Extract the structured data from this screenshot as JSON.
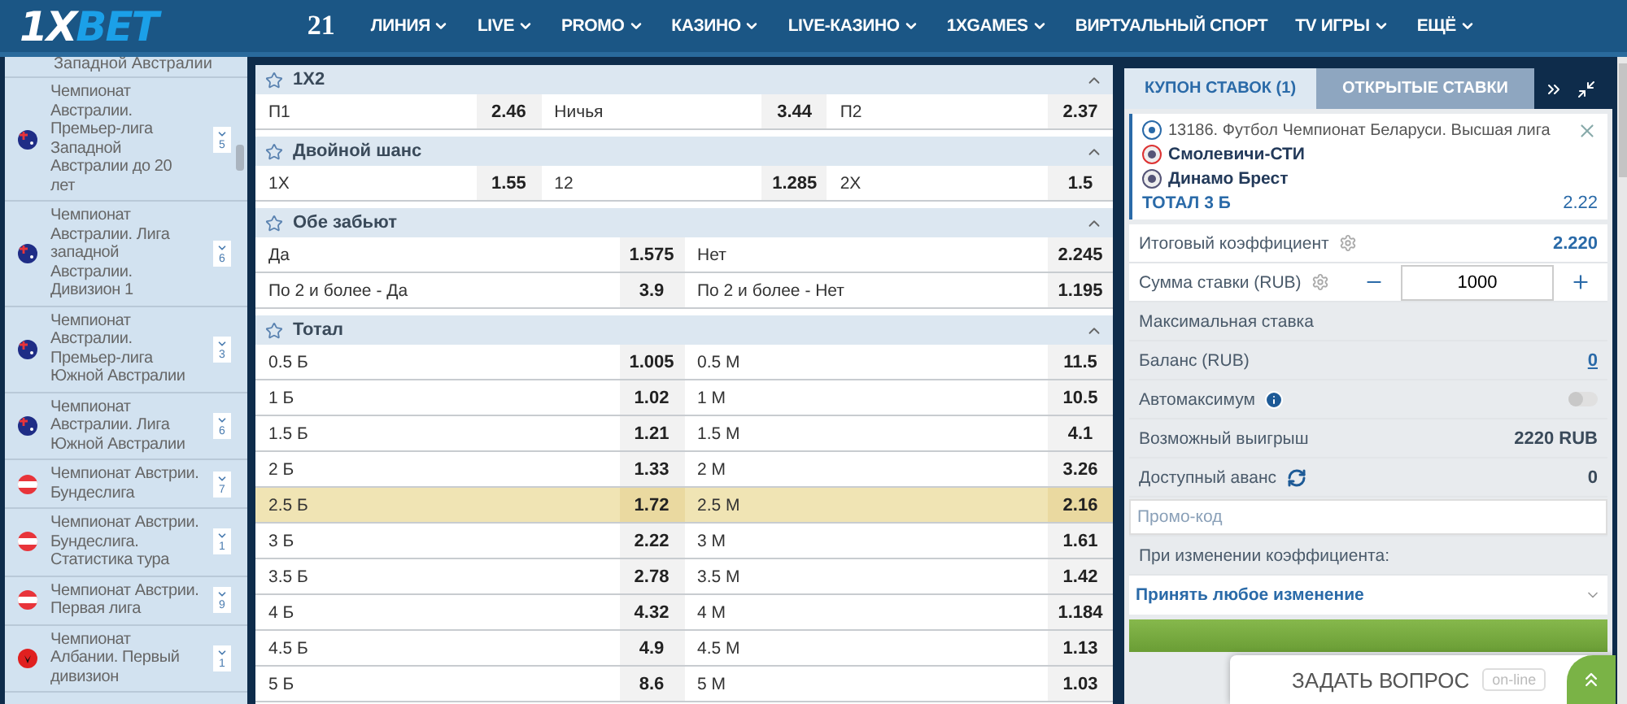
{
  "header": {
    "logo": {
      "part_1": "1X",
      "part_2": "BET"
    },
    "badge": "21",
    "nav": [
      {
        "label": "ЛИНИЯ",
        "dropdown": true
      },
      {
        "label": "LIVE",
        "dropdown": true
      },
      {
        "label": "PROMO",
        "dropdown": true
      },
      {
        "label": "КАЗИНО",
        "dropdown": true
      },
      {
        "label": "LIVE-КАЗИНО",
        "dropdown": true
      },
      {
        "label": "1XGAMES",
        "dropdown": true
      },
      {
        "label": "ВИРТУАЛЬНЫЙ СПОРТ",
        "dropdown": false
      },
      {
        "label": "TV ИГРЫ",
        "dropdown": true
      },
      {
        "label": "ЕЩЁ",
        "dropdown": true
      }
    ]
  },
  "sidebar": {
    "partial_item": "Западной Австралии",
    "items": [
      {
        "title": "Чемпионат Австралии. Премьер-лига Западной Австралии до 20 лет",
        "kind": "australia",
        "count": "5"
      },
      {
        "title": "Чемпионат Австралии. Лига западной Австралии. Дивизион 1",
        "kind": "australia",
        "count": "6"
      },
      {
        "title": "Чемпионат Австралии. Премьер-лига Южной Австралии",
        "kind": "australia",
        "count": "3"
      },
      {
        "title": "Чемпионат Австралии. Лига Южной Австралии",
        "kind": "australia",
        "count": "6"
      },
      {
        "title": "Чемпионат Австрии. Бундеслига",
        "kind": "austria",
        "count": "7"
      },
      {
        "title": "Чемпионат Австрии. Бундеслига. Статистика тура",
        "kind": "austria",
        "count": "1"
      },
      {
        "title": "Чемпионат Австрии. Первая лига",
        "kind": "austria",
        "count": "9"
      },
      {
        "title": "Чемпионат Албании. Первый дивизион",
        "kind": "albania",
        "count": "1"
      }
    ]
  },
  "markets": [
    {
      "title": "1X2",
      "rows": [
        {
          "selected": false,
          "outcomes": [
            {
              "label": "П1",
              "odds": "2.46"
            },
            {
              "label": "Ничья",
              "odds": "3.44"
            },
            {
              "label": "П2",
              "odds": "2.37"
            }
          ]
        }
      ]
    },
    {
      "title": "Двойной шанс",
      "rows": [
        {
          "selected": false,
          "outcomes": [
            {
              "label": "1X",
              "odds": "1.55"
            },
            {
              "label": "12",
              "odds": "1.285"
            },
            {
              "label": "2X",
              "odds": "1.5"
            }
          ]
        }
      ]
    },
    {
      "title": "Обе забьют",
      "rows": [
        {
          "selected": false,
          "outcomes": [
            {
              "label": "Да",
              "odds": "1.575"
            },
            {
              "label": "Нет",
              "odds": "2.245"
            }
          ]
        },
        {
          "selected": false,
          "outcomes": [
            {
              "label": "По 2 и более - Да",
              "odds": "3.9"
            },
            {
              "label": "По 2 и более - Нет",
              "odds": "1.195"
            }
          ]
        }
      ]
    },
    {
      "title": "Тотал",
      "rows": [
        {
          "selected": false,
          "outcomes": [
            {
              "label": "0.5 Б",
              "odds": "1.005"
            },
            {
              "label": "0.5 М",
              "odds": "11.5"
            }
          ]
        },
        {
          "selected": false,
          "outcomes": [
            {
              "label": "1 Б",
              "odds": "1.02"
            },
            {
              "label": "1 М",
              "odds": "10.5"
            }
          ]
        },
        {
          "selected": false,
          "outcomes": [
            {
              "label": "1.5 Б",
              "odds": "1.21"
            },
            {
              "label": "1.5 М",
              "odds": "4.1"
            }
          ]
        },
        {
          "selected": false,
          "outcomes": [
            {
              "label": "2 Б",
              "odds": "1.33"
            },
            {
              "label": "2 М",
              "odds": "3.26"
            }
          ]
        },
        {
          "selected": true,
          "outcomes": [
            {
              "label": "2.5 Б",
              "odds": "1.72"
            },
            {
              "label": "2.5 М",
              "odds": "2.16"
            }
          ]
        },
        {
          "selected": false,
          "outcomes": [
            {
              "label": "3 Б",
              "odds": "2.22"
            },
            {
              "label": "3 М",
              "odds": "1.61"
            }
          ]
        },
        {
          "selected": false,
          "outcomes": [
            {
              "label": "3.5 Б",
              "odds": "2.78"
            },
            {
              "label": "3.5 М",
              "odds": "1.42"
            }
          ]
        },
        {
          "selected": false,
          "outcomes": [
            {
              "label": "4 Б",
              "odds": "4.32"
            },
            {
              "label": "4 М",
              "odds": "1.184"
            }
          ]
        },
        {
          "selected": false,
          "outcomes": [
            {
              "label": "4.5 Б",
              "odds": "4.9"
            },
            {
              "label": "4.5 М",
              "odds": "1.13"
            }
          ]
        },
        {
          "selected": false,
          "outcomes": [
            {
              "label": "5 Б",
              "odds": "8.6"
            },
            {
              "label": "5 М",
              "odds": "1.03"
            }
          ]
        }
      ]
    }
  ],
  "coupon": {
    "tabs": [
      {
        "label": "КУПОН СТАВОК (1)",
        "selected": true
      },
      {
        "label": "ОТКРЫТЫЕ СТАВКИ",
        "selected": false
      }
    ],
    "event": "13186. Футбол Чемпионат Беларуси. Высшая лига",
    "teams": [
      "Смолевичи-СТИ",
      "Динамо Брест"
    ],
    "bet": "ТОТАЛ 3 Б",
    "bet_odds": "2.22",
    "rows": [
      {
        "kind": "total",
        "label": "Итоговый коэффициент",
        "value": "2.220"
      },
      {
        "kind": "stake",
        "label": "Сумма ставки (RUB)",
        "value": "1000"
      },
      {
        "kind": "plain",
        "label": "Максимальная ставка"
      },
      {
        "kind": "balance",
        "label": "Баланс (RUB)",
        "value": "0"
      },
      {
        "kind": "toggle",
        "label": "Автомаксимум",
        "on": false
      },
      {
        "kind": "info",
        "label": "Возможный выигрыш",
        "value": "2220 RUB"
      },
      {
        "kind": "advance",
        "label": "Доступный аванс",
        "value": "0"
      },
      {
        "kind": "promo",
        "placeholder": "Промо-код"
      },
      {
        "kind": "note",
        "label": "При изменении коэффициента:"
      },
      {
        "kind": "select",
        "value": "Принять любое изменение"
      },
      {
        "kind": "submit"
      }
    ]
  },
  "chat": {
    "label": "ЗАДАТЬ ВОПРОС",
    "status": "on-line"
  }
}
